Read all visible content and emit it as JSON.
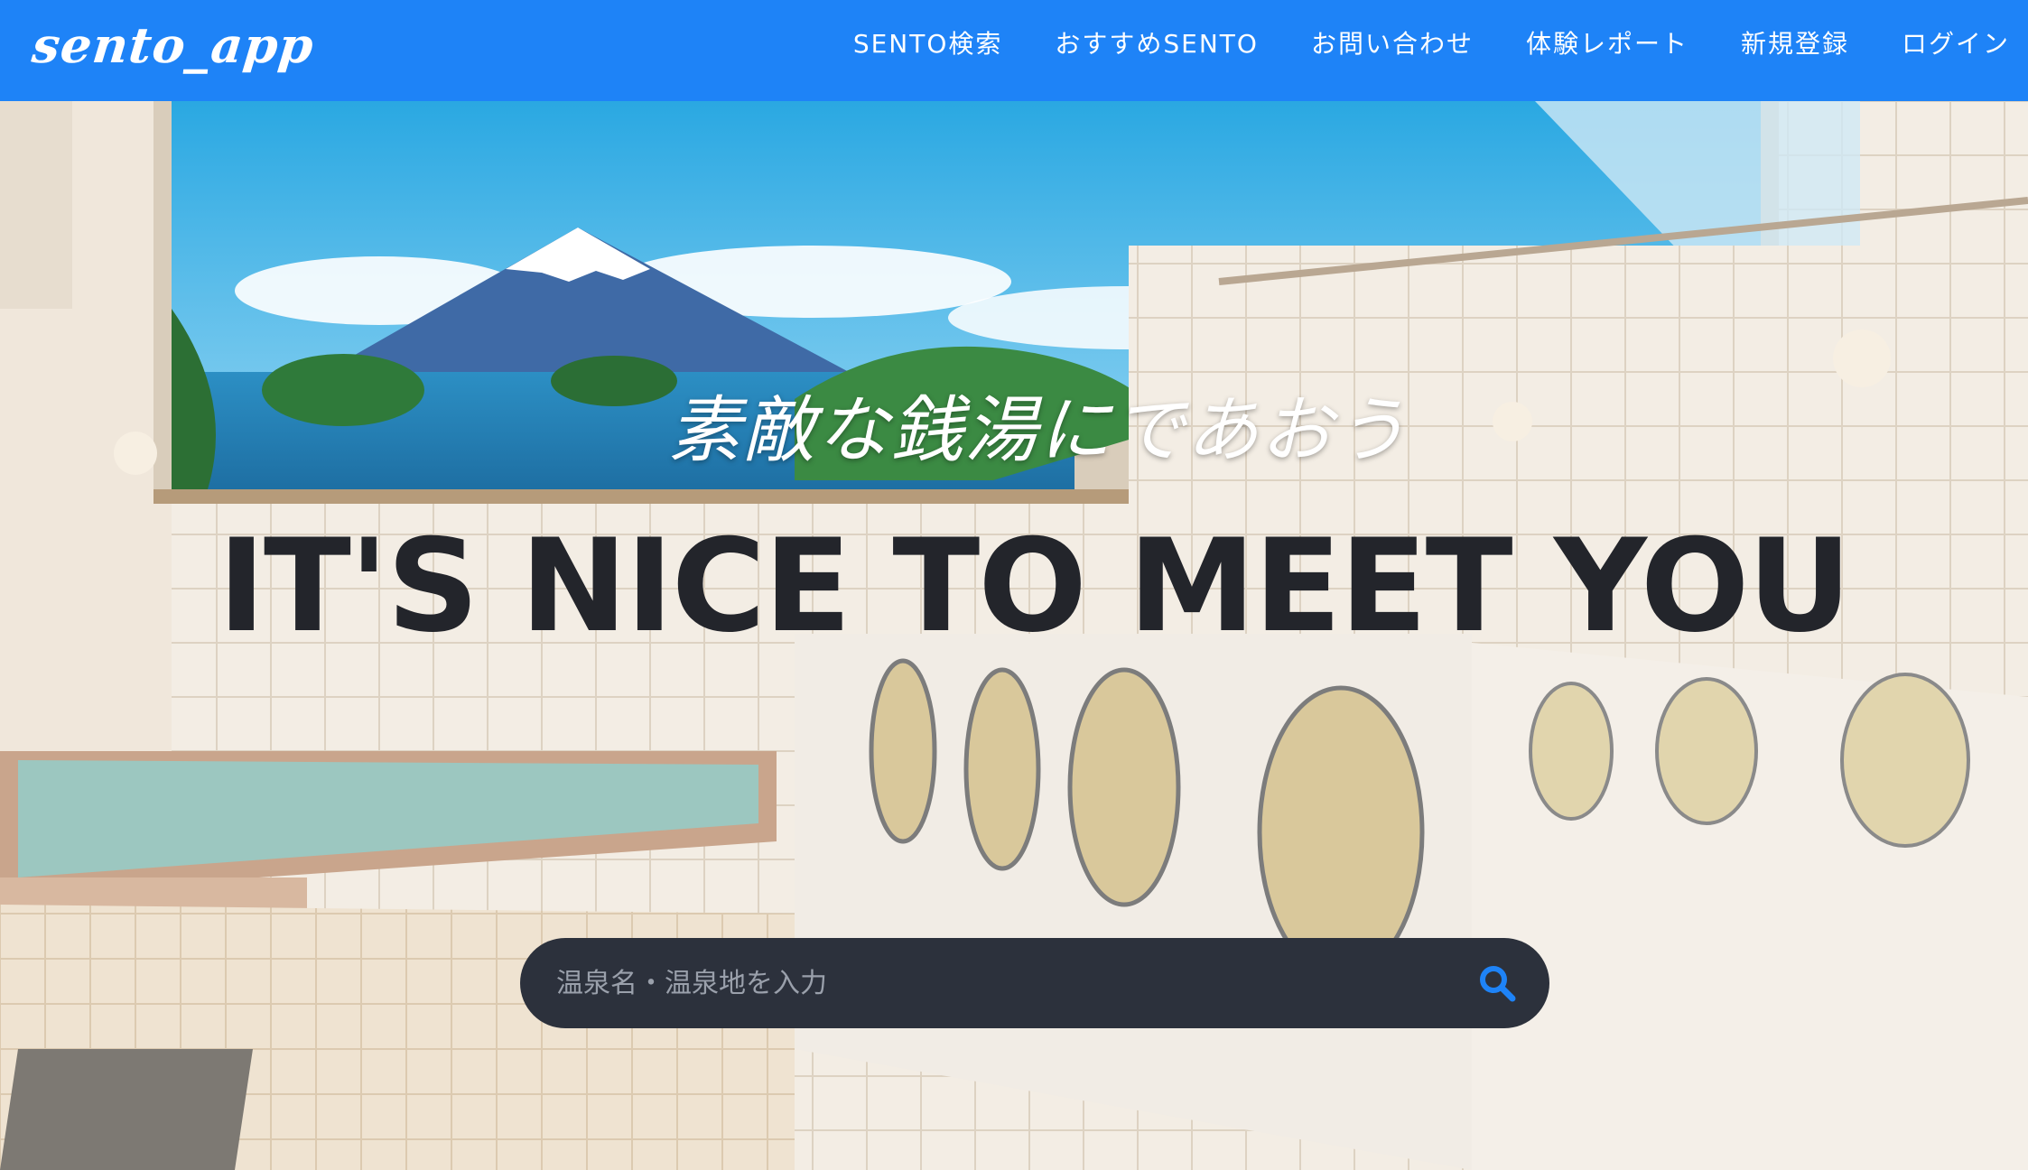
{
  "brand": {
    "logo_text": "sento_app"
  },
  "nav": {
    "items": [
      {
        "label": "SENTO検索"
      },
      {
        "label": "おすすめSENTO"
      },
      {
        "label": "お問い合わせ"
      },
      {
        "label": "体験レポート"
      },
      {
        "label": "新規登録"
      },
      {
        "label": "ログイン"
      }
    ]
  },
  "hero": {
    "subtitle": "素敵な銭湯にであおう",
    "title": "IT'S NICE TO MEET YOU",
    "search": {
      "placeholder": "温泉名・温泉地を入力",
      "value": "",
      "icon": "search-icon"
    }
  },
  "colors": {
    "navbar": "#1e83f7",
    "search_bar": "#2c313c",
    "search_icon": "#1e83f7",
    "title_text": "#23252b"
  }
}
